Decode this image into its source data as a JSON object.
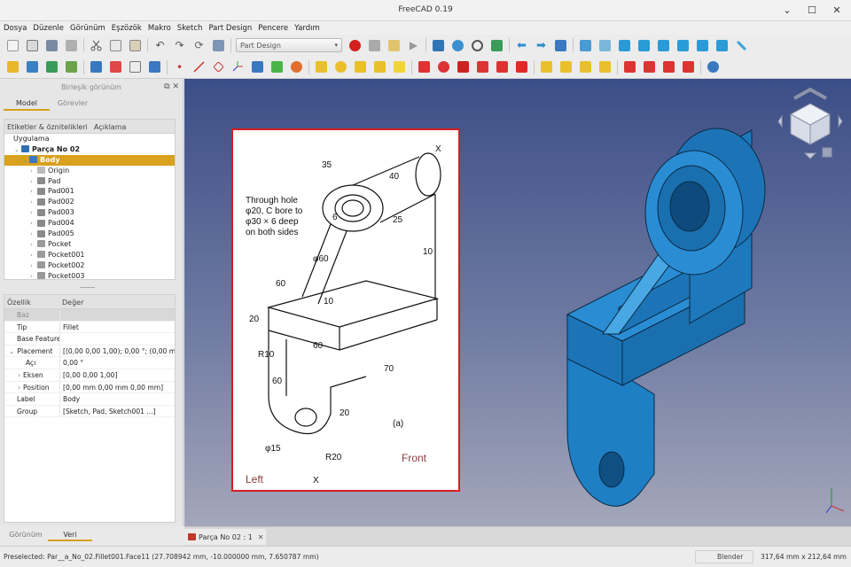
{
  "window": {
    "title": "FreeCAD 0.19",
    "minimize": "⌄",
    "maximize": "☐",
    "close": "✕"
  },
  "menubar": [
    "Dosya",
    "Düzenle",
    "Görünüm",
    "Eşzözök",
    "Makro",
    "Sketch",
    "Part Design",
    "Pencere",
    "Yardım"
  ],
  "toolbar": {
    "workbench": "Part Design"
  },
  "left_panel": {
    "title": "Birleşik görünüm",
    "tabs": [
      "Model",
      "Görevler"
    ],
    "tree_header": [
      "Etiketler & öznitelikleri",
      "Açıklama"
    ],
    "tree": [
      {
        "label": "Uygulama",
        "indent": 0,
        "arrow": "",
        "icon": ""
      },
      {
        "label": "Parça No 02",
        "indent": 1,
        "arrow": "⌄",
        "icon": "part-icon"
      },
      {
        "label": "Body",
        "indent": 2,
        "arrow": "⌄",
        "icon": "body-icon",
        "selected": true
      },
      {
        "label": "Origin",
        "indent": 3,
        "arrow": "›",
        "icon": "origin-icon"
      },
      {
        "label": "Pad",
        "indent": 3,
        "arrow": "›",
        "icon": "pad-icon"
      },
      {
        "label": "Pad001",
        "indent": 3,
        "arrow": "›",
        "icon": "pad-icon"
      },
      {
        "label": "Pad002",
        "indent": 3,
        "arrow": "›",
        "icon": "pad-icon"
      },
      {
        "label": "Pad003",
        "indent": 3,
        "arrow": "›",
        "icon": "pad-icon"
      },
      {
        "label": "Pad004",
        "indent": 3,
        "arrow": "›",
        "icon": "pad-icon"
      },
      {
        "label": "Pad005",
        "indent": 3,
        "arrow": "›",
        "icon": "pad-icon"
      },
      {
        "label": "Pocket",
        "indent": 3,
        "arrow": "›",
        "icon": "pocket-icon"
      },
      {
        "label": "Pocket001",
        "indent": 3,
        "arrow": "›",
        "icon": "pocket-icon"
      },
      {
        "label": "Pocket002",
        "indent": 3,
        "arrow": "›",
        "icon": "pocket-icon"
      },
      {
        "label": "Pocket003",
        "indent": 3,
        "arrow": "›",
        "icon": "pocket-icon"
      }
    ],
    "props_header": [
      "Özellik",
      "Değer"
    ],
    "props": [
      {
        "k": "Baz",
        "v": "",
        "group": true
      },
      {
        "k": "Tip",
        "v": "Fillet"
      },
      {
        "k": "Base Feature",
        "v": ""
      },
      {
        "k": "Placement",
        "v": "[(0,00 0,00 1,00); 0,00 °; (0,00 mm ...",
        "arrow": "⌄"
      },
      {
        "k": "Açı",
        "v": "0,00 °",
        "sub": true
      },
      {
        "k": "Eksen",
        "v": "[0,00 0,00 1,00]",
        "sub": true,
        "arrow": "›"
      },
      {
        "k": "Position",
        "v": "[0,00 mm  0,00 mm  0,00 mm]",
        "sub": true,
        "arrow": "›"
      },
      {
        "k": "Label",
        "v": "Body"
      },
      {
        "k": "Group",
        "v": "[Sketch, Pad, Sketch001 ...]"
      }
    ],
    "bottom_tabs": [
      "Görünüm",
      "Veri"
    ]
  },
  "drawing": {
    "note": [
      "Through hole",
      "φ20, C bore to",
      "φ30 × 6 deep",
      "on both sides"
    ],
    "dims": {
      "d35": "35",
      "d40": "40",
      "d25": "25",
      "d10a": "10",
      "d10b": "10",
      "d6": "6",
      "d60a": "φ60",
      "d60b": "60",
      "d60c": "60",
      "d60d": "60",
      "d20a": "20",
      "d20b": "20",
      "r10": "R10",
      "d70": "70",
      "d15": "φ15",
      "r20": "R20",
      "x1": "X",
      "x2": "X"
    },
    "label_a": "(a)",
    "front": "Front",
    "left": "Left"
  },
  "doc_tab": {
    "label": "Parça No 02 : 1",
    "close": "✕"
  },
  "status": {
    "preselected": "Preselected: Par__a_No_02.Fillet001.Face11 (27.708942 mm, -10.000000 mm, 7.650787 mm)",
    "nav": "Blender",
    "dims": "317,64 mm x 212,64 mm"
  },
  "colors": {
    "part_blue": "#1f7fc4",
    "selection": "#d8a11e",
    "drawing_border": "#d81c24"
  }
}
